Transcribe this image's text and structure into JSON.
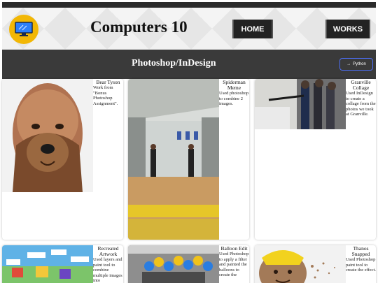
{
  "header": {
    "title": "Computers 10",
    "nav": [
      {
        "label": "HOME"
      },
      {
        "label": "WORKS"
      }
    ]
  },
  "banner": {
    "title": "Photoshop/InDesign",
    "python_button": "Python"
  },
  "cards": [
    {
      "title": "Bear Tyson",
      "description": "Work from \"Bonus Photoshop Assignment\"."
    },
    {
      "title": "Spiderman Meme",
      "description": "Used photoshop to combine 2 images."
    },
    {
      "title": "Granville Collage",
      "description": "Used InDesign to create a collage from the photos we took at Granville."
    },
    {
      "title": "Recreated Artwork",
      "description": "Used layers and paint tool to combine multiple images into"
    },
    {
      "title": "Balloon Edit",
      "description": "Used Photoshop to apply a filter and painted the balloons to create the"
    },
    {
      "title": "Thanos Snapped",
      "description": "Used Photoshop paint tool to create the effect."
    }
  ],
  "colors": {
    "topbar": "#2b2b2b",
    "banner": "#3a3a3a",
    "logo": "#f2b705",
    "python_border": "#4c6ef5"
  }
}
